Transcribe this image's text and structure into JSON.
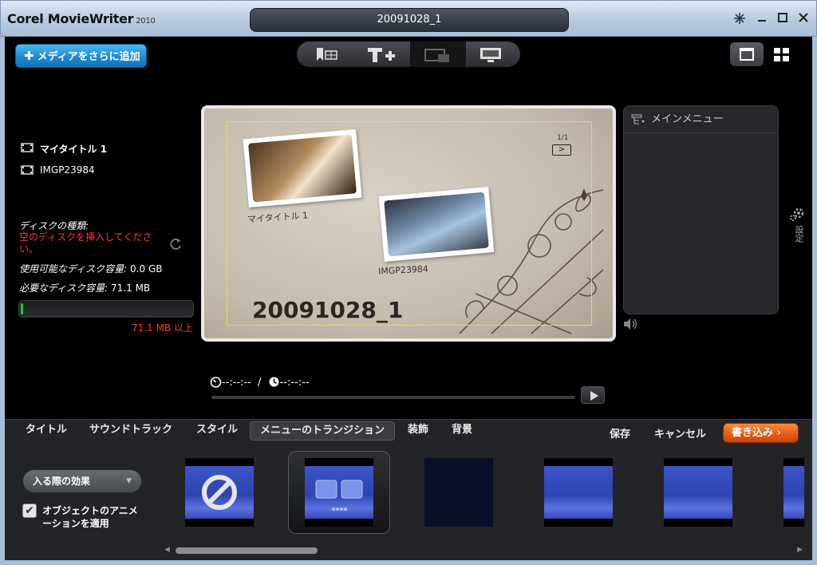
{
  "window": {
    "app_name": "Corel MovieWriter",
    "app_year": "2010",
    "document_title": "20091028_1"
  },
  "toolbar": {
    "add_media_label": "メディアをさらに追加"
  },
  "disk": {
    "type_label": "ディスクの種類:",
    "warning": "空のディスクを挿入してください。",
    "available_label": "使用可能なディスク容量:",
    "available_value": "0.0 GB",
    "required_label": "必要なディスク容量:",
    "required_value": "71.1 MB",
    "over_text": "71.1 MB 以上",
    "usage_fraction": 0.01
  },
  "preview": {
    "page_indicator": "1/1",
    "next_symbol": ">",
    "photo1_label": "マイタイトル 1",
    "photo2_label": "IMGP23984",
    "menu_title": "20091028_1"
  },
  "menu_panel": {
    "header": "メインメニュー",
    "items": [
      "マイタイトル 1",
      "IMGP23984"
    ]
  },
  "settings_label": "設定",
  "timeline": {
    "current": "--:--:--",
    "separator": "/",
    "total": "--:--:--"
  },
  "tabs": [
    "タイトル",
    "サウンドトラック",
    "スタイル",
    "メニューのトランジション",
    "装飾",
    "背景"
  ],
  "actions": {
    "save": "保存",
    "cancel": "キャンセル",
    "burn": "書き込み"
  },
  "effects": {
    "select_value": "入る際の効果",
    "checkbox_label": "オブジェクトのアニメーションを適用",
    "checkbox_checked": true
  },
  "colors": {
    "accent_blue": "#1b86cf",
    "burn_orange": "#e35a12",
    "warning_red": "#ff3a2a",
    "safe_area_yellow": "#e4e23a"
  }
}
